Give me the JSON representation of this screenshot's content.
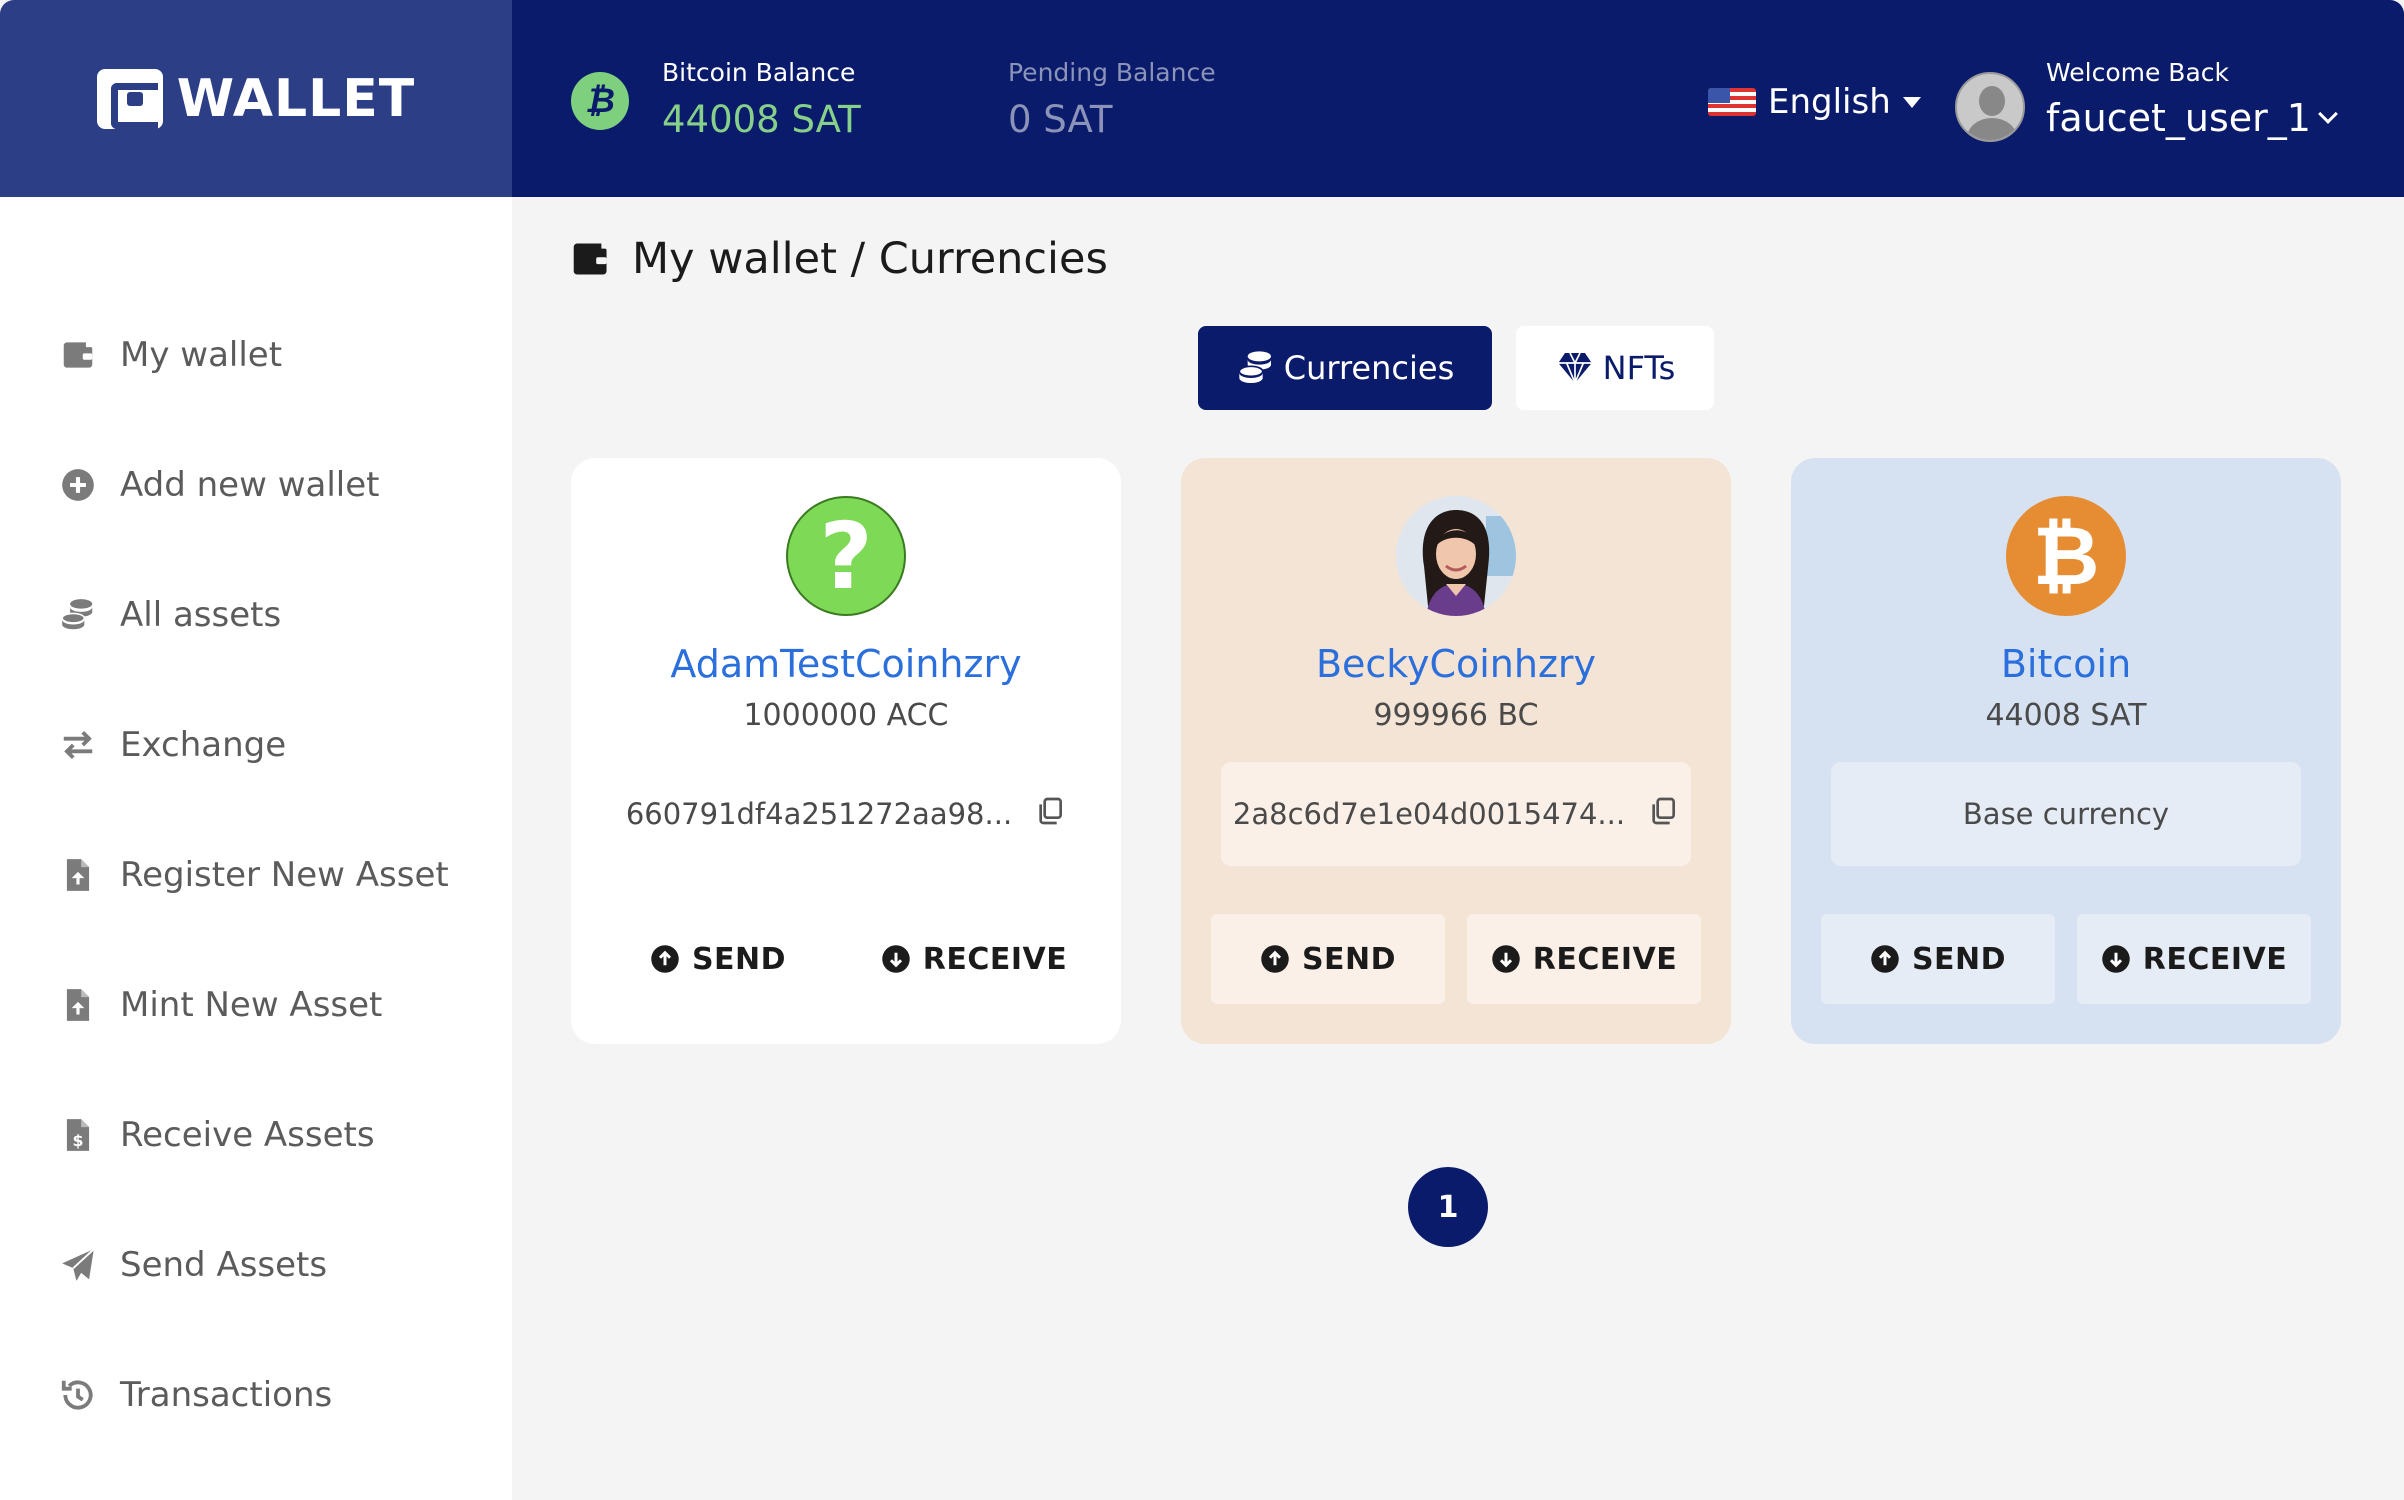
{
  "app": {
    "logo_text": "WALLET"
  },
  "header": {
    "bitcoin_balance_label": "Bitcoin Balance",
    "bitcoin_balance_value": "44008 SAT",
    "pending_balance_label": "Pending Balance",
    "pending_balance_value": "0 SAT",
    "language": "English",
    "welcome": "Welcome Back",
    "username": "faucet_user_1"
  },
  "sidebar": {
    "items": [
      {
        "label": "My wallet",
        "icon": "wallet-icon"
      },
      {
        "label": "Add new wallet",
        "icon": "plus-circle-icon"
      },
      {
        "label": "All assets",
        "icon": "coins-icon"
      },
      {
        "label": "Exchange",
        "icon": "exchange-icon"
      },
      {
        "label": "Register New Asset",
        "icon": "file-upload-icon"
      },
      {
        "label": "Mint New Asset",
        "icon": "file-upload-icon"
      },
      {
        "label": "Receive Assets",
        "icon": "file-dollar-icon"
      },
      {
        "label": "Send Assets",
        "icon": "paper-plane-icon"
      },
      {
        "label": "Transactions",
        "icon": "history-icon"
      }
    ]
  },
  "main": {
    "title": "My wallet / Currencies",
    "tabs": [
      {
        "label": "Currencies",
        "active": true
      },
      {
        "label": "NFTs",
        "active": false
      }
    ],
    "cards": [
      {
        "name": "AdamTestCoinhzry",
        "balance": "1000000 ACC",
        "address": "660791df4a251272aa98...",
        "send": "SEND",
        "receive": "RECEIVE"
      },
      {
        "name": "BeckyCoinhzry",
        "balance": "999966 BC",
        "address": "2a8c6d7e1e04d0015474...",
        "send": "SEND",
        "receive": "RECEIVE"
      },
      {
        "name": "Bitcoin",
        "balance": "44008 SAT",
        "address": "Base currency",
        "send": "SEND",
        "receive": "RECEIVE"
      }
    ],
    "pagination": {
      "current": "1"
    }
  },
  "colors": {
    "header_bg": "#0b1b6b",
    "logo_bg": "#2c3f86",
    "balance_green": "#86d08a",
    "link_blue": "#2a6fdc",
    "bitcoin_orange": "#e68d33"
  }
}
